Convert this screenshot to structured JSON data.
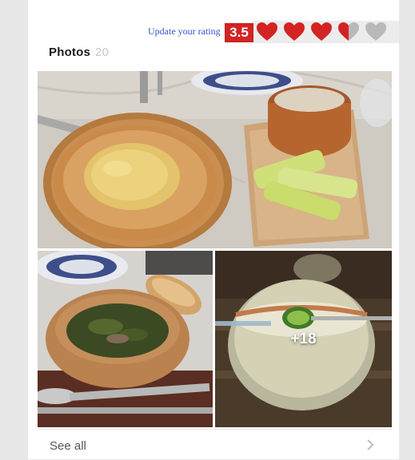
{
  "rating": {
    "update_label": "Update your rating",
    "score": "3.5",
    "hearts_total": 5,
    "hearts_value": 3.5,
    "heart_color": "#d32323",
    "heart_empty_color": "#b9b9b9"
  },
  "photos": {
    "title": "Photos",
    "count": "20",
    "more_label": "+18",
    "see_all_label": "See all"
  },
  "icons": {
    "heart": "heart-icon",
    "chevron": "chevron-right-icon"
  }
}
